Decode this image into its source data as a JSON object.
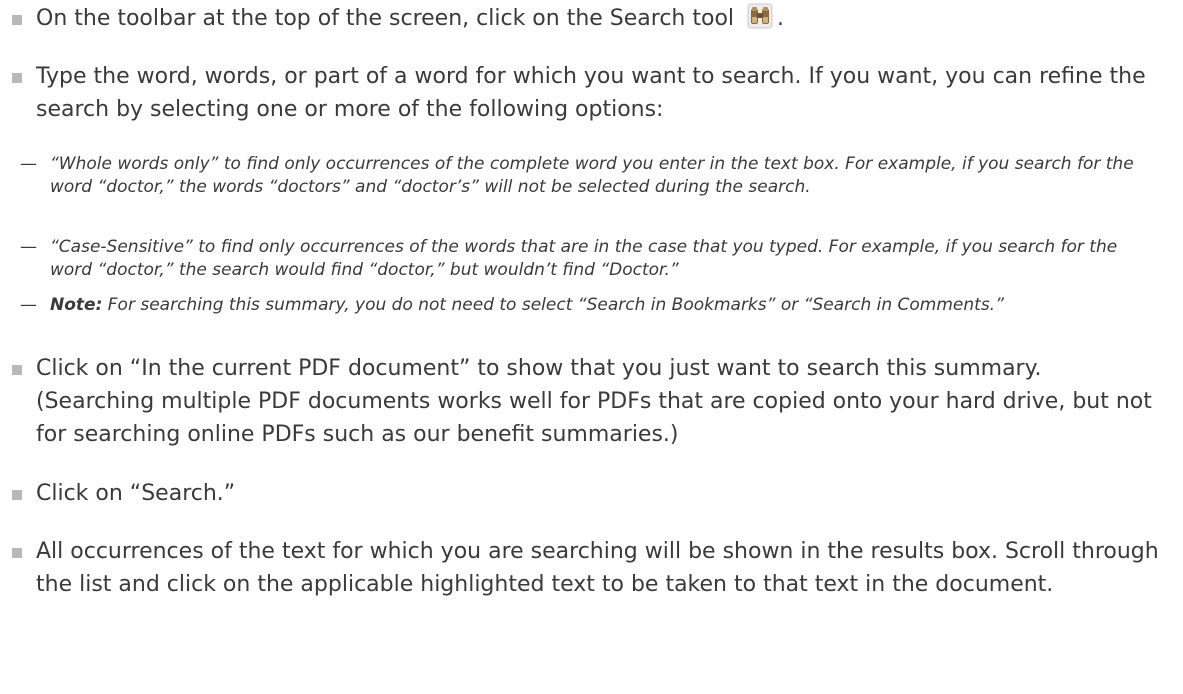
{
  "bullets": {
    "b1": {
      "before": "On the toolbar at the top of the screen, click on the Search tool",
      "after": "."
    },
    "b2": {
      "text": "Type the word, words, or part of a word for which you want to search.  If you want, you can refine the search by selecting one or more of the following options:"
    },
    "b3": {
      "text": "Click on “In the current PDF document” to show that you just want to search this summary. (Searching multiple PDF documents works well for PDFs that are copied onto your hard drive, but not for searching online PDFs such as our benefit summaries.)"
    },
    "b4": {
      "text": "Click on “Search.”"
    },
    "b5": {
      "text": "All occurrences of the text for which you are searching will be shown in the results box. Scroll through the list and click on the applicable highlighted text to be taken to that text in the document."
    }
  },
  "options": {
    "dash": "—",
    "o1": {
      "text": "“Whole words only” to find only occurrences of the complete word you enter in the text box.  For example, if you search for the word “doctor,” the words “doctors” and “doctor’s” will not be selected during the search."
    },
    "o2": {
      "text": "“Case-Sensitive” to find only occurrences of the words that are in the case that you typed.  For example, if you search for the word “doctor,” the search would find “doctor,” but wouldn’t find “Doctor.”"
    },
    "o3": {
      "label": "Note:",
      "text": " For searching this summary, you do not need to select “Search in Bookmarks” or “Search in Comments.”"
    }
  },
  "icons": {
    "search_tool": "binoculars-icon"
  },
  "colors": {
    "text": "#3a3a3a",
    "bullet": "#b9b9b9"
  }
}
